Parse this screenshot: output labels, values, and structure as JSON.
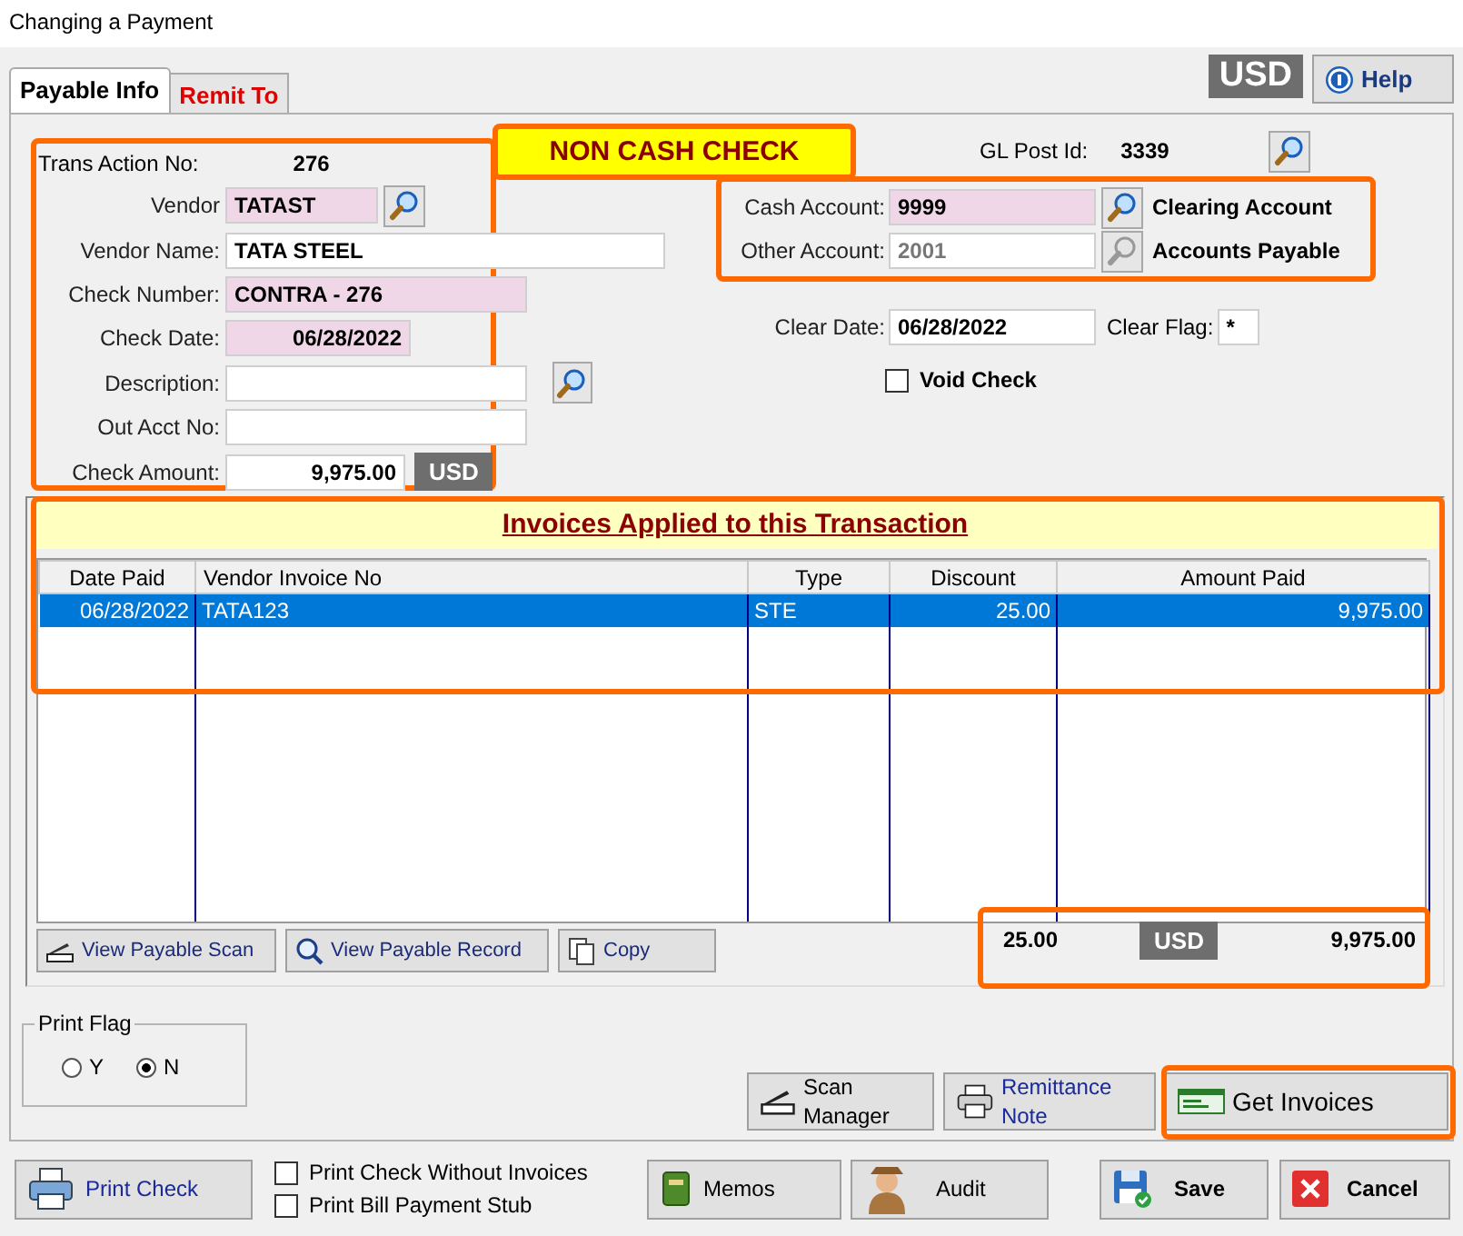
{
  "window": {
    "title": "Changing a Payment"
  },
  "tabs": [
    {
      "label": "Payable Info",
      "selected": true
    },
    {
      "label": "Remit To",
      "selected": false
    }
  ],
  "currency_badge": "USD",
  "help_button": "Help",
  "transaction": {
    "label": "Trans Action No:",
    "value": "276"
  },
  "fields": [
    {
      "label": "Vendor",
      "value": "TATAST",
      "kind": "lookup",
      "highlighted": true
    },
    {
      "label": "Vendor Name:",
      "value": "TATA STEEL",
      "kind": "wide",
      "highlighted": false
    },
    {
      "label": "Check Number:",
      "value": "CONTRA - 276",
      "kind": "medium",
      "highlighted": true
    },
    {
      "label": "Check Date:",
      "value": "06/28/2022",
      "kind": "date",
      "highlighted": true
    },
    {
      "label": "Description:",
      "kind": "medium_lookup",
      "highlighted": false
    },
    {
      "label": "Out Acct No:",
      "kind": "medium",
      "highlighted": false
    },
    {
      "label": "Check Amount:",
      "value": "9,975.00",
      "kind": "amount",
      "highlighted": false,
      "currency": "USD"
    }
  ],
  "banner": "NON CASH CHECK",
  "gl_post": {
    "label": "GL Post Id:",
    "value": "3339"
  },
  "accounts": [
    {
      "label": "Cash Account:",
      "value": "9999",
      "highlighted": true,
      "disabled": false,
      "account_name": "Clearing Account"
    },
    {
      "label": "Other Account:",
      "value": "2001",
      "highlighted": false,
      "disabled": true,
      "account_name": "Accounts Payable"
    }
  ],
  "clear_date": {
    "label": "Clear Date:",
    "value": "06/28/2022"
  },
  "clear_flag": {
    "label": "Clear Flag:",
    "value": "*"
  },
  "void_check": {
    "label": "Void Check",
    "checked": false
  },
  "invoices": {
    "title": "Invoices Applied to this Transaction",
    "columns": [
      "Date Paid",
      "Vendor Invoice No",
      "Type",
      "Discount",
      "Amount Paid"
    ],
    "rows": [
      {
        "cells": [
          "06/28/2022",
          "TATA123",
          "STE",
          "25.00",
          "9,975.00"
        ],
        "selected": true
      }
    ]
  },
  "grid_buttons": [
    "View Payable Scan",
    "View Payable Record",
    "Copy"
  ],
  "totals": {
    "discount": "25.00",
    "currency": "USD",
    "amount": "9,975.00"
  },
  "print_flag": {
    "title": "Print Flag",
    "options": [
      {
        "label": "Y",
        "selected": false
      },
      {
        "label": "N",
        "selected": true
      }
    ]
  },
  "action_buttons": [
    "Scan Manager",
    "Remittance Note",
    "Get Invoices"
  ],
  "print_options": [
    {
      "label": "Print Check Without Invoices",
      "checked": false
    },
    {
      "label": "Print Bill Payment Stub",
      "checked": false
    }
  ],
  "bottom_buttons": [
    "Print Check",
    "Memos",
    "Audit",
    "Save",
    "Cancel"
  ]
}
